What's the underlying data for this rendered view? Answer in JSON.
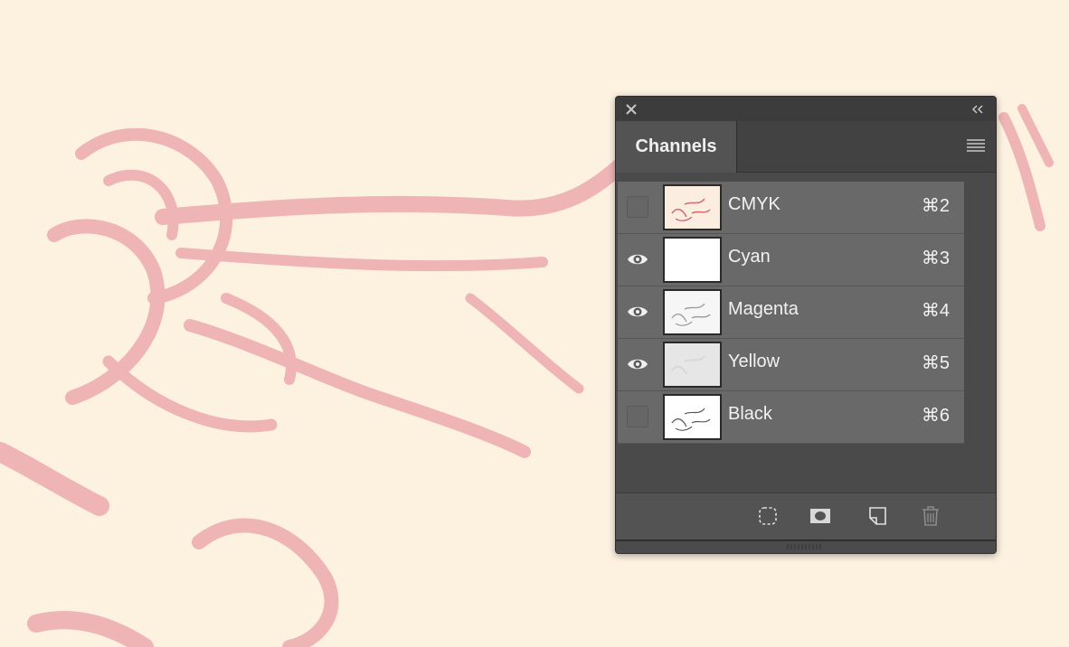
{
  "panel": {
    "tab_label": "Channels",
    "channels": [
      {
        "name": "CMYK",
        "shortcut": "⌘2",
        "visible": false,
        "thumb": "cmyk"
      },
      {
        "name": "Cyan",
        "shortcut": "⌘3",
        "visible": true,
        "thumb": "cyan"
      },
      {
        "name": "Magenta",
        "shortcut": "⌘4",
        "visible": true,
        "thumb": "magenta"
      },
      {
        "name": "Yellow",
        "shortcut": "⌘5",
        "visible": true,
        "thumb": "yellow"
      },
      {
        "name": "Black",
        "shortcut": "⌘6",
        "visible": false,
        "thumb": "black"
      }
    ],
    "toolbar_icons": [
      "load-selection-icon",
      "save-selection-icon",
      "new-channel-icon",
      "trash-icon"
    ]
  },
  "colors": {
    "canvas": "#fdf1e0",
    "sketch_stroke": "#e8919a",
    "panel_bg": "#535353",
    "row_bg": "#696969"
  }
}
